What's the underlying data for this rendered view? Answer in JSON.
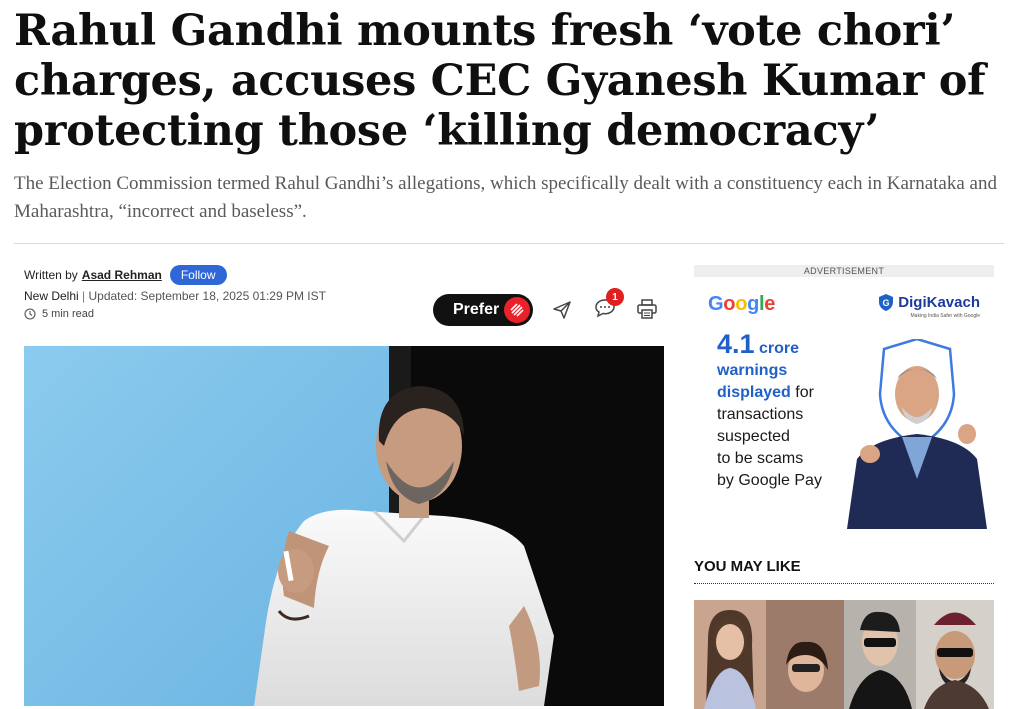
{
  "article": {
    "headline": "Rahul Gandhi mounts fresh ‘vote chori’ charges, accuses CEC Gyanesh Kumar of protecting those ‘killing democracy’",
    "subhead": "The Election Commission termed Rahul Gandhi’s allegations, which specifically dealt with a constituency each in Karnataka and Maharashtra, “incorrect and baseless”.",
    "byline_prefix": "Written by",
    "author": "Asad Rehman",
    "follow_label": "Follow",
    "location": "New Delhi",
    "separator": " | ",
    "updated": "Updated: September 18, 2025 01:29 PM IST",
    "read_time": "5 min read"
  },
  "actions": {
    "prefer_label": "Prefer",
    "comment_count": "1",
    "icons": [
      "share-icon",
      "comment-icon",
      "print-icon"
    ]
  },
  "ad": {
    "label": "ADVERTISEMENT",
    "brand": "Google",
    "partner": "DigiKavach",
    "partner_tagline": "Making India Safer with Google",
    "stat": "4.1",
    "stat_unit": "crore",
    "line1": "warnings",
    "line2": "displayed",
    "line2_rest": " for",
    "line3": "transactions",
    "line4": "suspected",
    "line5": "to be scams",
    "line6": "by Google Pay"
  },
  "sidebar": {
    "you_may_like": "YOU MAY LIKE"
  },
  "colors": {
    "follow_blue": "#2f67d8",
    "badge_red": "#e02020",
    "ad_blue": "#1f61c9",
    "prefer_bg": "#111111"
  }
}
